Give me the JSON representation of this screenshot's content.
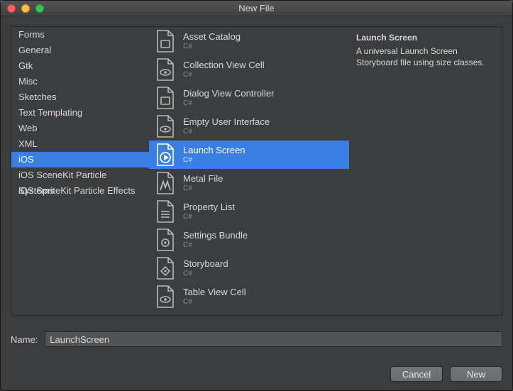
{
  "window": {
    "title": "New File"
  },
  "categories": [
    {
      "label": "Forms",
      "selected": false
    },
    {
      "label": "General",
      "selected": false
    },
    {
      "label": "Gtk",
      "selected": false
    },
    {
      "label": "Misc",
      "selected": false
    },
    {
      "label": "Sketches",
      "selected": false
    },
    {
      "label": "Text Templating",
      "selected": false
    },
    {
      "label": "Web",
      "selected": false
    },
    {
      "label": "XML",
      "selected": false
    },
    {
      "label": "iOS",
      "selected": true
    },
    {
      "label": "iOS SceneKit Particle Systems",
      "selected": false
    },
    {
      "label": "iOS SpriteKit Particle Effects",
      "selected": false
    }
  ],
  "templates": [
    {
      "name": "Asset Catalog",
      "lang": "C#",
      "icon": "square",
      "selected": false
    },
    {
      "name": "Collection View Cell",
      "lang": "C#",
      "icon": "eye",
      "selected": false
    },
    {
      "name": "Dialog View Controller",
      "lang": "C#",
      "icon": "square",
      "selected": false
    },
    {
      "name": "Empty User Interface",
      "lang": "C#",
      "icon": "eye",
      "selected": false
    },
    {
      "name": "Launch Screen",
      "lang": "C#",
      "icon": "play",
      "selected": true
    },
    {
      "name": "Metal File",
      "lang": "C#",
      "icon": "metal",
      "selected": false
    },
    {
      "name": "Property List",
      "lang": "C#",
      "icon": "list",
      "selected": false
    },
    {
      "name": "Settings Bundle",
      "lang": "C#",
      "icon": "gear",
      "selected": false
    },
    {
      "name": "Storyboard",
      "lang": "C#",
      "icon": "diamond",
      "selected": false
    },
    {
      "name": "Table View Cell",
      "lang": "C#",
      "icon": "eye",
      "selected": false
    }
  ],
  "description": {
    "title": "Launch Screen",
    "body": "A universal Launch Screen Storyboard file using size classes."
  },
  "nameField": {
    "label": "Name:",
    "value": "LaunchScreen"
  },
  "buttons": {
    "cancel": "Cancel",
    "new": "New"
  }
}
